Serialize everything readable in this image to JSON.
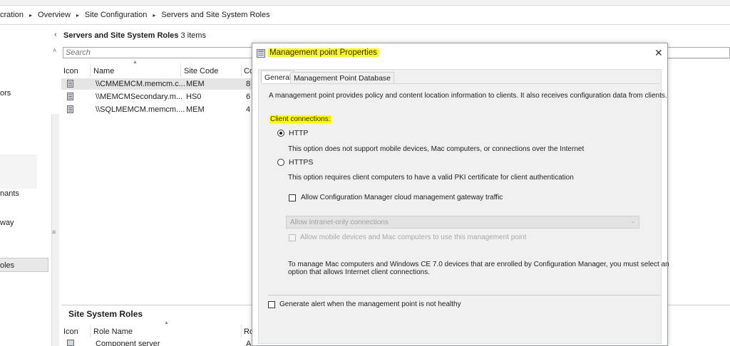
{
  "breadcrumb": {
    "items": [
      "cration",
      "Overview",
      "Site Configuration",
      "Servers and Site System Roles"
    ],
    "separator": "▸"
  },
  "left_nav": {
    "items": [
      "ors",
      "nants",
      "way",
      "oles"
    ],
    "selected_index": 3,
    "splitter_glyph": "≡"
  },
  "content": {
    "collapse_glyph": "‹",
    "up_glyph": "˄",
    "title": "Servers and Site System Roles",
    "count": "3 items",
    "search_placeholder": "Search",
    "sort_glyph": "▲",
    "columns": [
      "Icon",
      "Name",
      "Site Code",
      "Co"
    ],
    "rows": [
      {
        "name": "\\\\CMMEMCM.memcm.c...",
        "site_code": "MEM",
        "co": "8",
        "selected": true
      },
      {
        "name": "\\\\MEMCMSecondary.m...",
        "site_code": "HS0",
        "co": "6",
        "selected": false
      },
      {
        "name": "\\\\SQLMEMCM.memcm....",
        "site_code": "MEM",
        "co": "4",
        "selected": false
      }
    ],
    "bottom_panel": {
      "title": "Site System Roles",
      "columns": [
        "Icon",
        "Role Name",
        "Ro"
      ],
      "rows": [
        {
          "role_name": "Component server",
          "ro": "A"
        }
      ]
    }
  },
  "dialog": {
    "title": "Management point Properties",
    "close_glyph": "✕",
    "tabs": [
      {
        "label": "General",
        "active": true
      },
      {
        "label": "Management Point Database",
        "active": false
      }
    ],
    "description": "A management point provides policy and content location information to clients.  It also receives configuration data from clients.",
    "client_connections_label": "Client connections:",
    "http": {
      "label": "HTTP",
      "checked": true,
      "note": "This option does not support mobile devices, Mac computers, or connections over the Internet"
    },
    "https": {
      "label": "HTTPS",
      "checked": false,
      "note": "This option requires client computers to have a valid PKI certificate for client authentication"
    },
    "cmg_checkbox": {
      "label": "Allow Configuration Manager cloud management gateway traffic",
      "checked": false
    },
    "connections_combo": {
      "value": "Allow intranet-only connections",
      "enabled": false
    },
    "mobile_checkbox": {
      "label": "Allow mobile devices and Mac computers to use this management point",
      "checked": false,
      "enabled": false
    },
    "mac_note_line1": "To manage Mac computers and Windows CE 7.0 devices that are enrolled by Configuration Manager, you must select an",
    "mac_note_line2": "option that allows Internet client connections.",
    "alert_checkbox": {
      "label": "Generate alert when the management point is not healthy",
      "checked": false
    }
  },
  "colors": {
    "highlight": "#ffff00",
    "selected_row": "#e5e5e5",
    "dialog_body": "#f0f0f0"
  }
}
